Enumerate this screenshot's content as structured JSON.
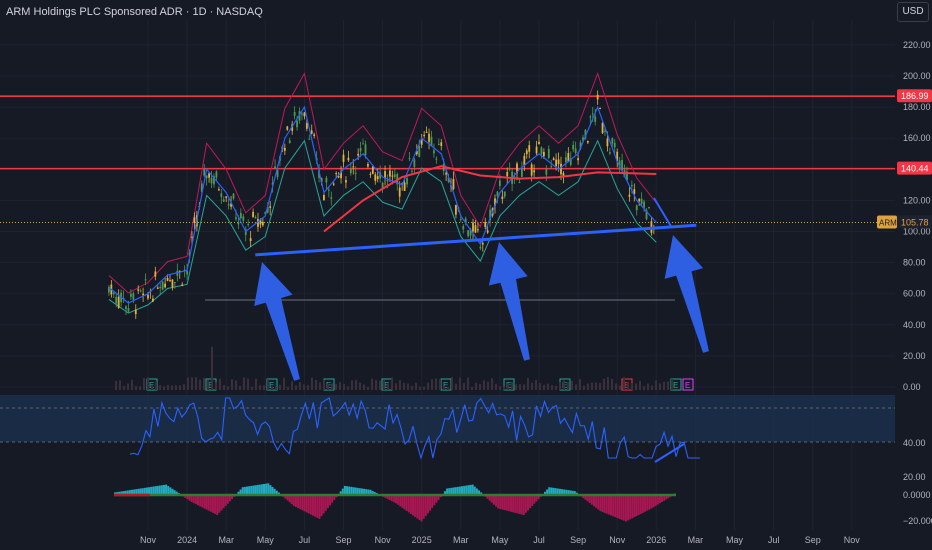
{
  "header": {
    "title": "ARM Holdings PLC Sponsored ADR · 1D · NASDAQ"
  },
  "toolbar": {
    "currency": "USD"
  },
  "colors": {
    "background": "#161a25",
    "price_line": "#2962ff",
    "resistance": "#f23645",
    "ma": "#f23645"
  },
  "chart_data": [
    {
      "type": "candlestick",
      "title": "ARM Holdings PLC Sponsored ADR · 1D · NASDAQ",
      "symbol": "ARM",
      "current_price": 105.78,
      "y_ticks": [
        0,
        20,
        40,
        60,
        80,
        100,
        120,
        140,
        160,
        180,
        200,
        220
      ],
      "y_tick_labels": [
        "0.00",
        "20.00",
        "40.00",
        "60.00",
        "80.00",
        "100.00",
        "120.00",
        "140.00",
        "160.00",
        "180.00",
        "200.00",
        "220.00"
      ],
      "ylim": [
        0,
        230
      ],
      "x_ticks": [
        "Nov",
        "2024",
        "Mar",
        "May",
        "Jul",
        "Sep",
        "Nov",
        "2025",
        "Mar",
        "May",
        "Jul",
        "Sep",
        "Nov",
        "2026",
        "Mar",
        "May",
        "Jul",
        "Sep",
        "Nov"
      ],
      "price_labels": [
        {
          "label": "186.99",
          "value": 186.99
        },
        {
          "label": "140.44",
          "value": 140.44
        },
        {
          "label": "105.78",
          "value": 105.78,
          "symbol": "ARM"
        }
      ],
      "horizontal_lines": [
        186.99,
        140.44
      ],
      "support_trendline": {
        "from": [
          "2024-05",
          85
        ],
        "to": [
          "2026-01",
          104
        ]
      },
      "price_series": [
        [
          "2023-09",
          64
        ],
        [
          "2023-10",
          54
        ],
        [
          "2023-11",
          60
        ],
        [
          "2023-12",
          72
        ],
        [
          "2024-01",
          75
        ],
        [
          "2024-02",
          140
        ],
        [
          "2024-03",
          125
        ],
        [
          "2024-04",
          100
        ],
        [
          "2024-05",
          110
        ],
        [
          "2024-06",
          160
        ],
        [
          "2024-07",
          180
        ],
        [
          "2024-08",
          125
        ],
        [
          "2024-09",
          140
        ],
        [
          "2024-10",
          150
        ],
        [
          "2024-11",
          135
        ],
        [
          "2024-12",
          130
        ],
        [
          "2025-01",
          160
        ],
        [
          "2025-02",
          150
        ],
        [
          "2025-03",
          110
        ],
        [
          "2025-04",
          92
        ],
        [
          "2025-05",
          125
        ],
        [
          "2025-06",
          140
        ],
        [
          "2025-07",
          150
        ],
        [
          "2025-08",
          140
        ],
        [
          "2025-09",
          150
        ],
        [
          "2025-10",
          180
        ],
        [
          "2025-11",
          145
        ],
        [
          "2025-12",
          120
        ],
        [
          "2026-01",
          105.78
        ]
      ],
      "moving_average": [
        [
          "2024-08",
          100
        ],
        [
          "2024-10",
          120
        ],
        [
          "2024-12",
          135
        ],
        [
          "2025-02",
          142
        ],
        [
          "2025-04",
          136
        ],
        [
          "2025-06",
          134
        ],
        [
          "2025-08",
          135
        ],
        [
          "2025-10",
          138
        ],
        [
          "2026-01",
          137
        ]
      ],
      "earnings_markers": [
        "E",
        "E",
        "E",
        "E",
        "E",
        "E",
        "E",
        "E",
        "E",
        "E",
        "E"
      ]
    },
    {
      "type": "line",
      "title": "",
      "y_ticks": [
        20,
        40
      ],
      "y_tick_labels": [
        "20.00",
        "40.00"
      ],
      "ylim": [
        10,
        70
      ],
      "band": [
        30,
        70
      ],
      "series": [
        {
          "values": [
            40,
            55,
            62,
            45,
            60,
            52,
            40,
            55,
            60,
            62,
            55,
            48,
            38,
            52,
            60,
            58,
            50,
            62,
            55,
            45,
            35,
            25,
            38,
            32
          ]
        }
      ],
      "divergence_line": {
        "from": [
          "2025-12",
          20
        ],
        "to": [
          "2026-01",
          29
        ]
      }
    },
    {
      "type": "bar",
      "title": "",
      "y_ticks": [
        0,
        -20
      ],
      "y_tick_labels": [
        "0.0000",
        "−20.0000"
      ],
      "ylim": [
        -30,
        15
      ],
      "values": [
        2,
        5,
        8,
        -5,
        -15,
        6,
        9,
        -8,
        -18,
        7,
        4,
        -6,
        -20,
        5,
        8,
        -10,
        -15,
        6,
        3,
        -12,
        -20,
        -10,
        2
      ]
    }
  ]
}
